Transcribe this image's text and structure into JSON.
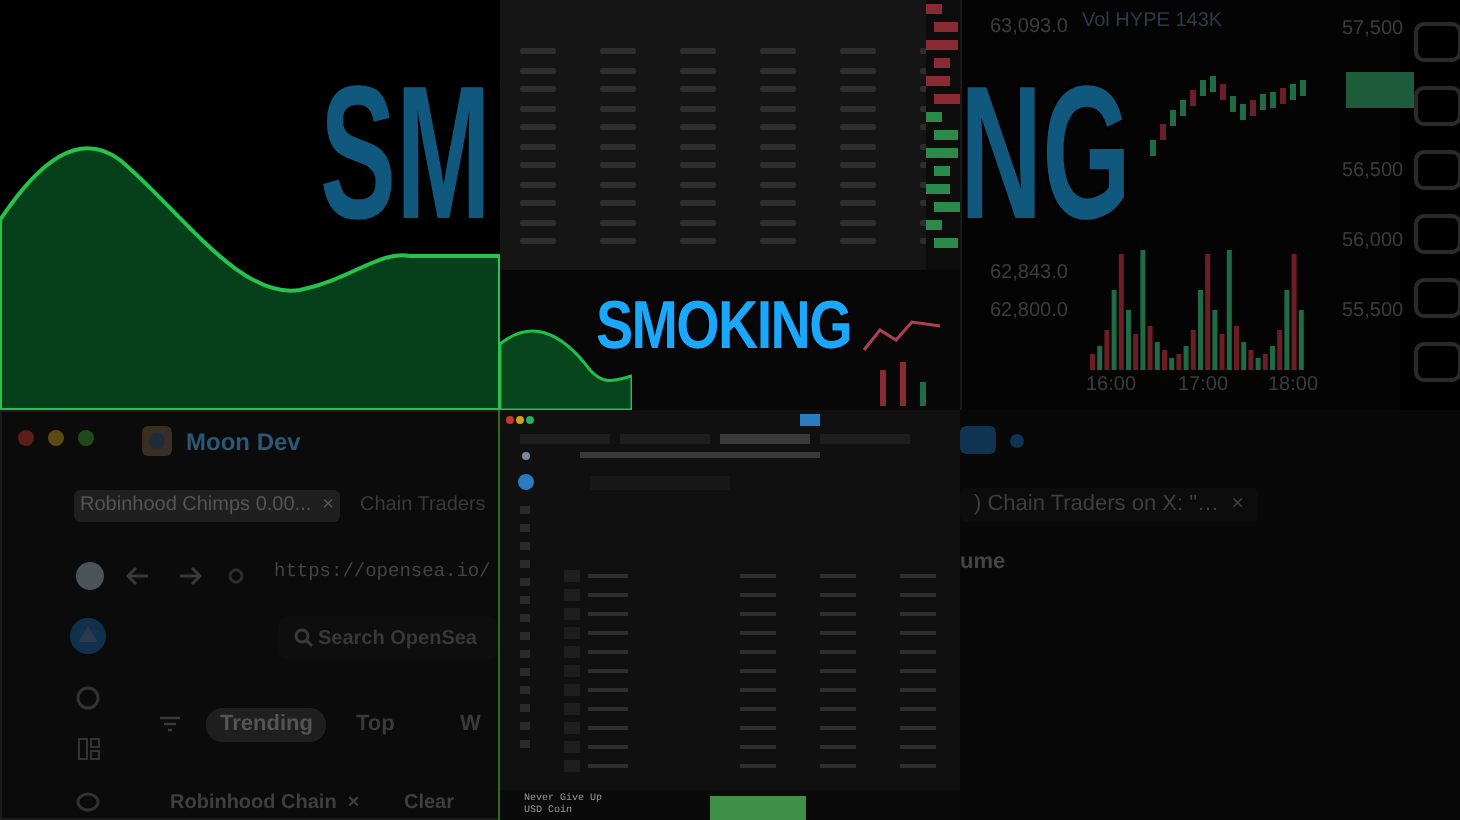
{
  "background_text": [
    {
      "text": "SM"
    },
    {
      "text": "NG"
    }
  ],
  "caption": "SMOKING",
  "price_chart": {
    "volume_label": "Vol HYPE 143K",
    "left_axis": [
      "63,093.0",
      "62,843.0",
      "62,800.0"
    ],
    "right_axis": [
      "57,500",
      "56,500",
      "56,000",
      "55,500"
    ],
    "times": [
      "16:00",
      "17:00",
      "18:00"
    ]
  },
  "browser_window": {
    "title": "Moon Dev",
    "tabs": [
      {
        "label": "Robinhood Chimps 0.00...",
        "close": "×",
        "selected": true
      },
      {
        "label": "Chain Traders",
        "selected": false
      }
    ],
    "url": "https://opensea.io/",
    "search": {
      "placeholder": "Search OpenSea"
    },
    "filters": [
      {
        "label": "Trending",
        "selected": true
      },
      {
        "label": "Top",
        "selected": false
      },
      {
        "label": "W",
        "selected": false
      }
    ],
    "chips": [
      {
        "label": "Robinhood Chain",
        "close": "×"
      }
    ],
    "clear": "Clear"
  },
  "second_window": {
    "tab": ") Chain Traders on X: \"…",
    "tab_close": "×",
    "column_header": "ume"
  },
  "terminal": {
    "rows": [
      {
        "name": "Never Give Up"
      },
      {
        "name": "USD Coin"
      }
    ]
  }
}
